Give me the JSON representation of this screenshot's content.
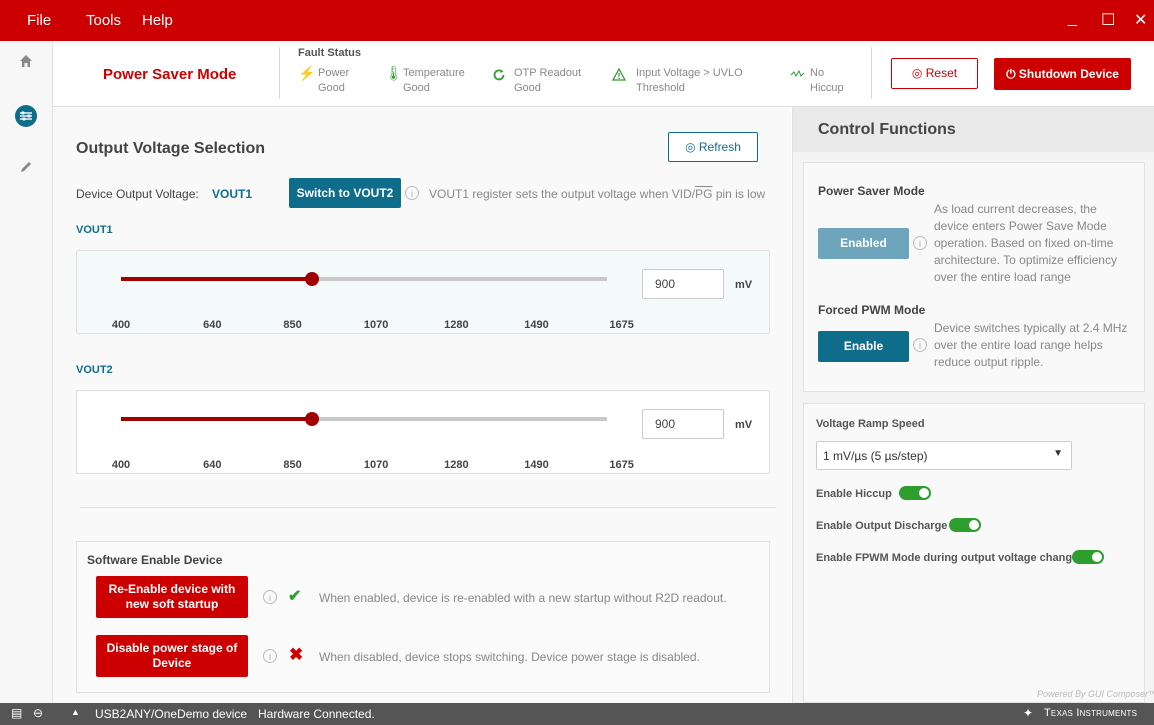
{
  "menu": {
    "file": "File",
    "tools": "Tools",
    "help": "Help"
  },
  "window": {
    "minimize": "_",
    "maximize": "☐",
    "close": "✕"
  },
  "header": {
    "mode_title": "Power Saver Mode",
    "fault_status_title": "Fault Status",
    "faults": [
      {
        "line1": "Power",
        "line2": "Good",
        "icon": "lightning-icon",
        "color": "#2e9e2e"
      },
      {
        "line1": "Temperature",
        "line2": "Good",
        "icon": "thermometer-icon",
        "color": "#2e9e2e"
      },
      {
        "line1": "OTP Readout",
        "line2": "Good",
        "icon": "refresh-circle-icon",
        "color": "#2e9e2e"
      },
      {
        "line1": "Input Voltage > UVLO",
        "line2": "Threshold",
        "icon": "warning-triangle-icon",
        "color": "#2e9e2e"
      },
      {
        "line1": "No",
        "line2": "Hiccup",
        "icon": "hiccup-wave-icon",
        "color": "#2e9e2e"
      }
    ],
    "reset_label": "Reset",
    "shutdown_label": "Shutdown Device"
  },
  "output_voltage": {
    "title": "Output Voltage Selection",
    "refresh_label": "Refresh",
    "device_output_label": "Device Output Voltage:",
    "device_output_value": "VOUT1",
    "switch_label": "Switch to VOUT2",
    "info_text_prefix": "VOUT1 register sets the output voltage when VID/",
    "info_text_pg": "PG",
    "info_text_suffix": " pin is low",
    "ticks": [
      "400",
      "640",
      "850",
      "1070",
      "1280",
      "1490",
      "1675"
    ],
    "min": 400,
    "max": 1675,
    "unit": "mV",
    "vout1": {
      "label": "VOUT1",
      "value": 900
    },
    "vout2": {
      "label": "VOUT2",
      "value": 900
    }
  },
  "software_enable": {
    "title": "Software Enable Device",
    "reenable_label": "Re-Enable device with new soft startup",
    "reenable_desc": "When enabled, device is re-enabled with a new startup without R2D readout.",
    "disable_label": "Disable power stage of Device",
    "disable_desc": "When disabled, device stops switching. Device power stage is disabled."
  },
  "control": {
    "title": "Control Functions",
    "psm_title": "Power Saver Mode",
    "psm_button": "Enabled",
    "psm_desc": "As load current decreases, the device enters Power Save Mode operation. Based on fixed on-time architecture. To optimize efficiency over the entire load range",
    "fpwm_title": "Forced PWM Mode",
    "fpwm_button": "Enable",
    "fpwm_desc": "Device switches typically at 2.4 MHz over the entire load range helps reduce output ripple.",
    "ramp_label": "Voltage Ramp Speed",
    "ramp_value": "1 mV/µs (5 µs/step)",
    "hiccup_label": "Enable Hiccup",
    "hiccup_on": true,
    "discharge_label": "Enable Output Discharge",
    "discharge_on": true,
    "fpwm_change_label": "Enable FPWM Mode during output voltage change",
    "fpwm_change_on": true
  },
  "status": {
    "connection": "USB2ANY/OneDemo device",
    "hardware": "Hardware Connected.",
    "powered_by": "Powered By GUI Composer™",
    "brand": "Texas Instruments"
  },
  "colors": {
    "accent_red": "#cc0000",
    "accent_blue": "#0f6d8c",
    "ok_green": "#2e9e2e"
  }
}
